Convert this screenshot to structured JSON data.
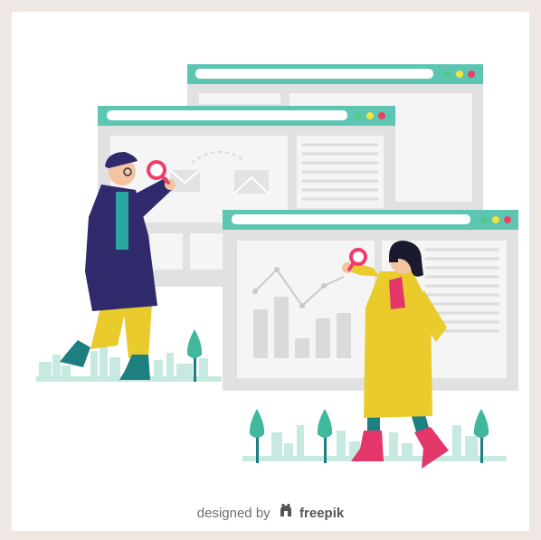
{
  "credit": {
    "prefix": "designed by",
    "brand": "freepik",
    "icon": "freepik-logo-icon"
  },
  "colors": {
    "page_background": "#efe7e4",
    "window_header": "#5cc6b3",
    "window_body": "#e1e1e1",
    "window_panel": "#f5f5f5",
    "dot_green": "#52c98a",
    "dot_yellow": "#f2e23a",
    "dot_red": "#ee3f65",
    "magnifier": "#f03d68",
    "coat_navy": "#2f2a6b",
    "coat_yellow": "#eacb2c",
    "boots_teal": "#1d7f7f",
    "boots_pink": "#e3366a",
    "city_silhouette": "#c6e9e2",
    "tree": "#40b89e"
  }
}
